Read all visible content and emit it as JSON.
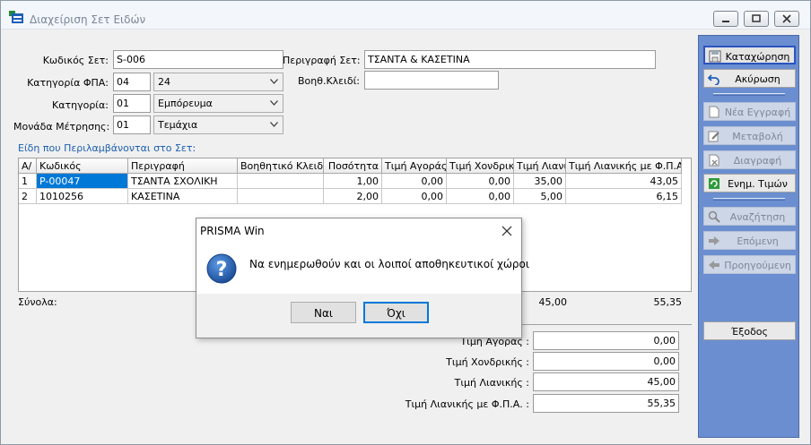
{
  "window": {
    "title": "Διαχείριση Σετ Ειδών",
    "icon": "app-window-icon"
  },
  "form": {
    "set_code_label": "Κωδικός Σετ:",
    "set_code_value": "S-006",
    "description_label": "Περιγραφή Σετ:",
    "description_value": "ΤΣΑΝΤΑ & ΚΑΣΕΤΙΝΑ",
    "vat_category_label": "Κατηγορία ΦΠΑ:",
    "vat_category_code": "04",
    "vat_category_selected": "24",
    "aux_key_label": "Βοηθ.Κλειδί:",
    "aux_key_value": "",
    "category_label": "Κατηγορία:",
    "category_code": "01",
    "category_selected": "Εμπόρευμα",
    "unit_label": "Μονάδα Μέτρησης:",
    "unit_code": "01",
    "unit_selected": "Τεμάχια"
  },
  "items_section": {
    "title": "Είδη που Περιλαμβάνονται στο Σετ:",
    "columns": [
      "Α/",
      "Κωδικός",
      "Περιγραφή",
      "Βοηθητικό Κλειδί",
      "Ποσότητα",
      "Τιμή Αγοράς",
      "Τιμή Χονδρικής",
      "Τιμή Λιανική",
      "Τιμή Λιανικής με Φ.Π.Α."
    ],
    "rows": [
      [
        "1",
        "P-00047",
        "ΤΣΑΝΤΑ ΣΧΟΛΙΚΗ",
        "",
        "1,00",
        "0,00",
        "0,00",
        "35,00",
        "43,05"
      ],
      [
        "2",
        "1010256",
        "ΚΑΣΕΤΙΝΑ",
        "",
        "2,00",
        "0,00",
        "0,00",
        "5,00",
        "6,15"
      ]
    ],
    "totals_label": "Σύνολα:",
    "totals_retail": "45,00",
    "totals_retail_vat": "55,35"
  },
  "summary": {
    "purchase_label": "Τιμή Αγοράς :",
    "purchase_value": "0,00",
    "wholesale_label": "Τιμή Χονδρικής :",
    "wholesale_value": "0,00",
    "retail_label": "Τιμή Λιανικής :",
    "retail_value": "45,00",
    "retail_vat_label": "Τιμή Λιανικής με Φ.Π.Α. :",
    "retail_vat_value": "55,35"
  },
  "actions": {
    "save": "Καταχώρηση",
    "cancel": "Ακύρωση",
    "new": "Νέα Εγγραφή",
    "edit": "Μεταβολή",
    "delete": "Διαγραφή",
    "update_prices": "Ενημ. Τιμών",
    "search": "Αναζήτηση",
    "next": "Επόμενη",
    "previous": "Προηγούμενη",
    "exit": "Έξοδος"
  },
  "dialog": {
    "title": "PRISMA Win",
    "message": "Να ενημερωθούν και οι λοιποί αποθηκευτικοί χώροι",
    "yes": "Ναι",
    "no": "Όχι",
    "icon": "question-icon"
  },
  "colors": {
    "panel": "#6a8ecf",
    "selection": "#0078d7",
    "section_title": "#1c5fb0"
  }
}
